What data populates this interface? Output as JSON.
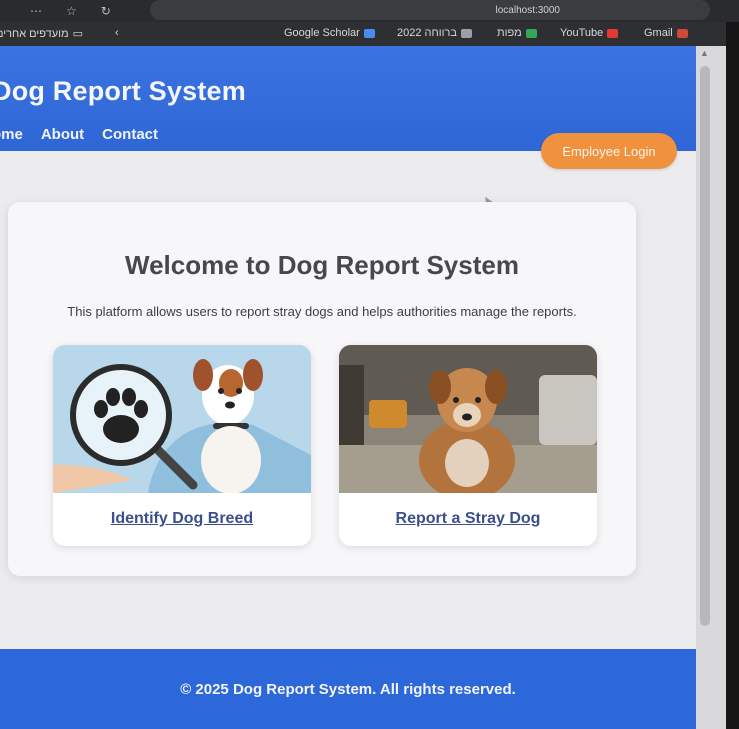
{
  "browser": {
    "tab_title": "localhost:3000",
    "bookmarks": {
      "folder": "מועדפים אחרים",
      "scholar": "Google Scholar",
      "bm2022": "2022 ברווחה",
      "mapot": "מפות",
      "youtube": "YouTube",
      "gmail": "Gmail"
    }
  },
  "site": {
    "title": "Dog Report System",
    "nav": [
      "ome",
      "About",
      "Contact"
    ],
    "login_label": "Employee Login"
  },
  "main": {
    "heading": "Welcome to Dog Report System",
    "intro": "This platform allows users to report stray dogs and helps authorities manage the reports.",
    "features": [
      {
        "label": "Identify Dog Breed",
        "icon": "paw-magnifier-icon"
      },
      {
        "label": "Report a Stray Dog",
        "icon": "stray-dog-photo"
      }
    ]
  },
  "footer": {
    "text": "© 2025 Dog Report System. All rights reserved."
  },
  "colors": {
    "header_blue": "#2f66d6",
    "login_orange": "#f0913f",
    "link_blue": "#3b4f8f",
    "footer_blue": "#2c68da"
  }
}
